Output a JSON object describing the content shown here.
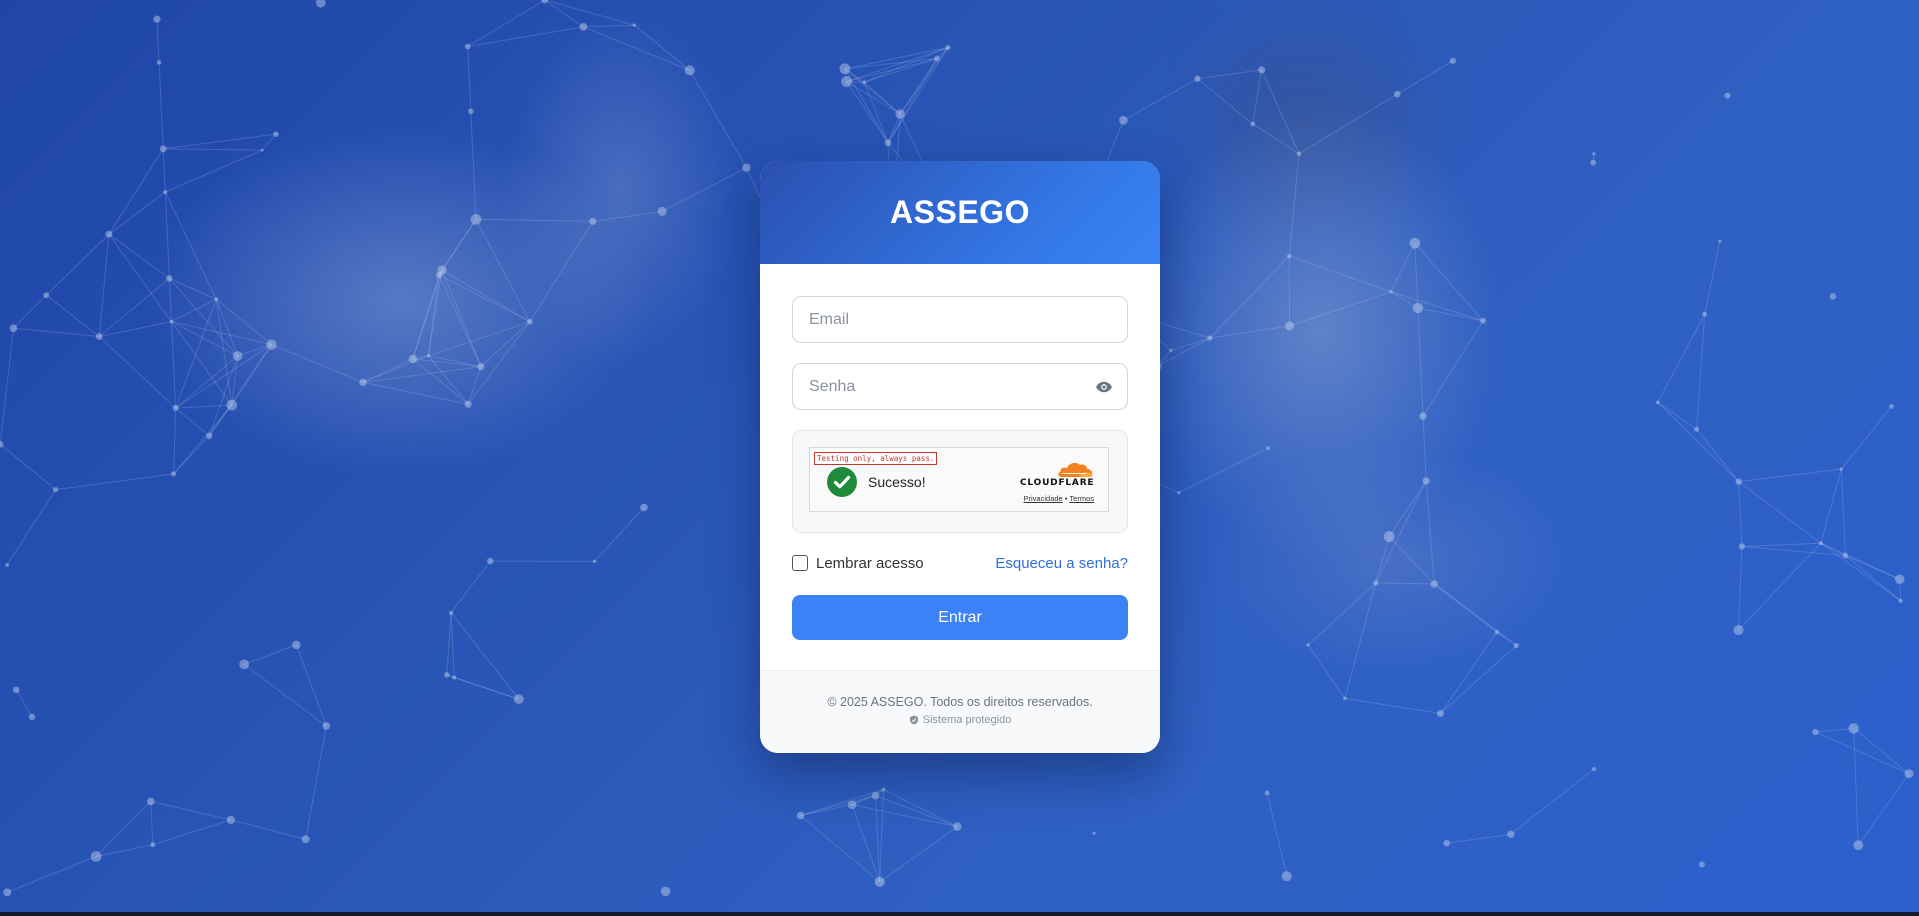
{
  "brand": {
    "title": "ASSEGO"
  },
  "form": {
    "email_placeholder": "Email",
    "password_placeholder": "Senha",
    "remember_label": "Lembrar acesso",
    "forgot_link": "Esqueceu a senha?",
    "submit_label": "Entrar"
  },
  "captcha": {
    "testing_notice": "Testing only, always pass.",
    "status_text": "Sucesso!",
    "provider": "CLOUDFLARE",
    "privacy_link": "Privacidade",
    "separator": "•",
    "terms_link": "Termos",
    "status_color": "#1f8a3c"
  },
  "footer": {
    "copyright": "© 2025 ASSEGO. Todos os direitos reservados.",
    "secure_text": "Sistema protegido"
  },
  "colors": {
    "accent": "#3b82f6",
    "header_start": "#2a4fb0",
    "link": "#2f6fe0"
  },
  "icons": {
    "password_toggle": "eye-icon",
    "captcha_status": "check-circle-icon",
    "captcha_brand": "cloudflare-logo",
    "footer_secure": "shield-icon"
  }
}
